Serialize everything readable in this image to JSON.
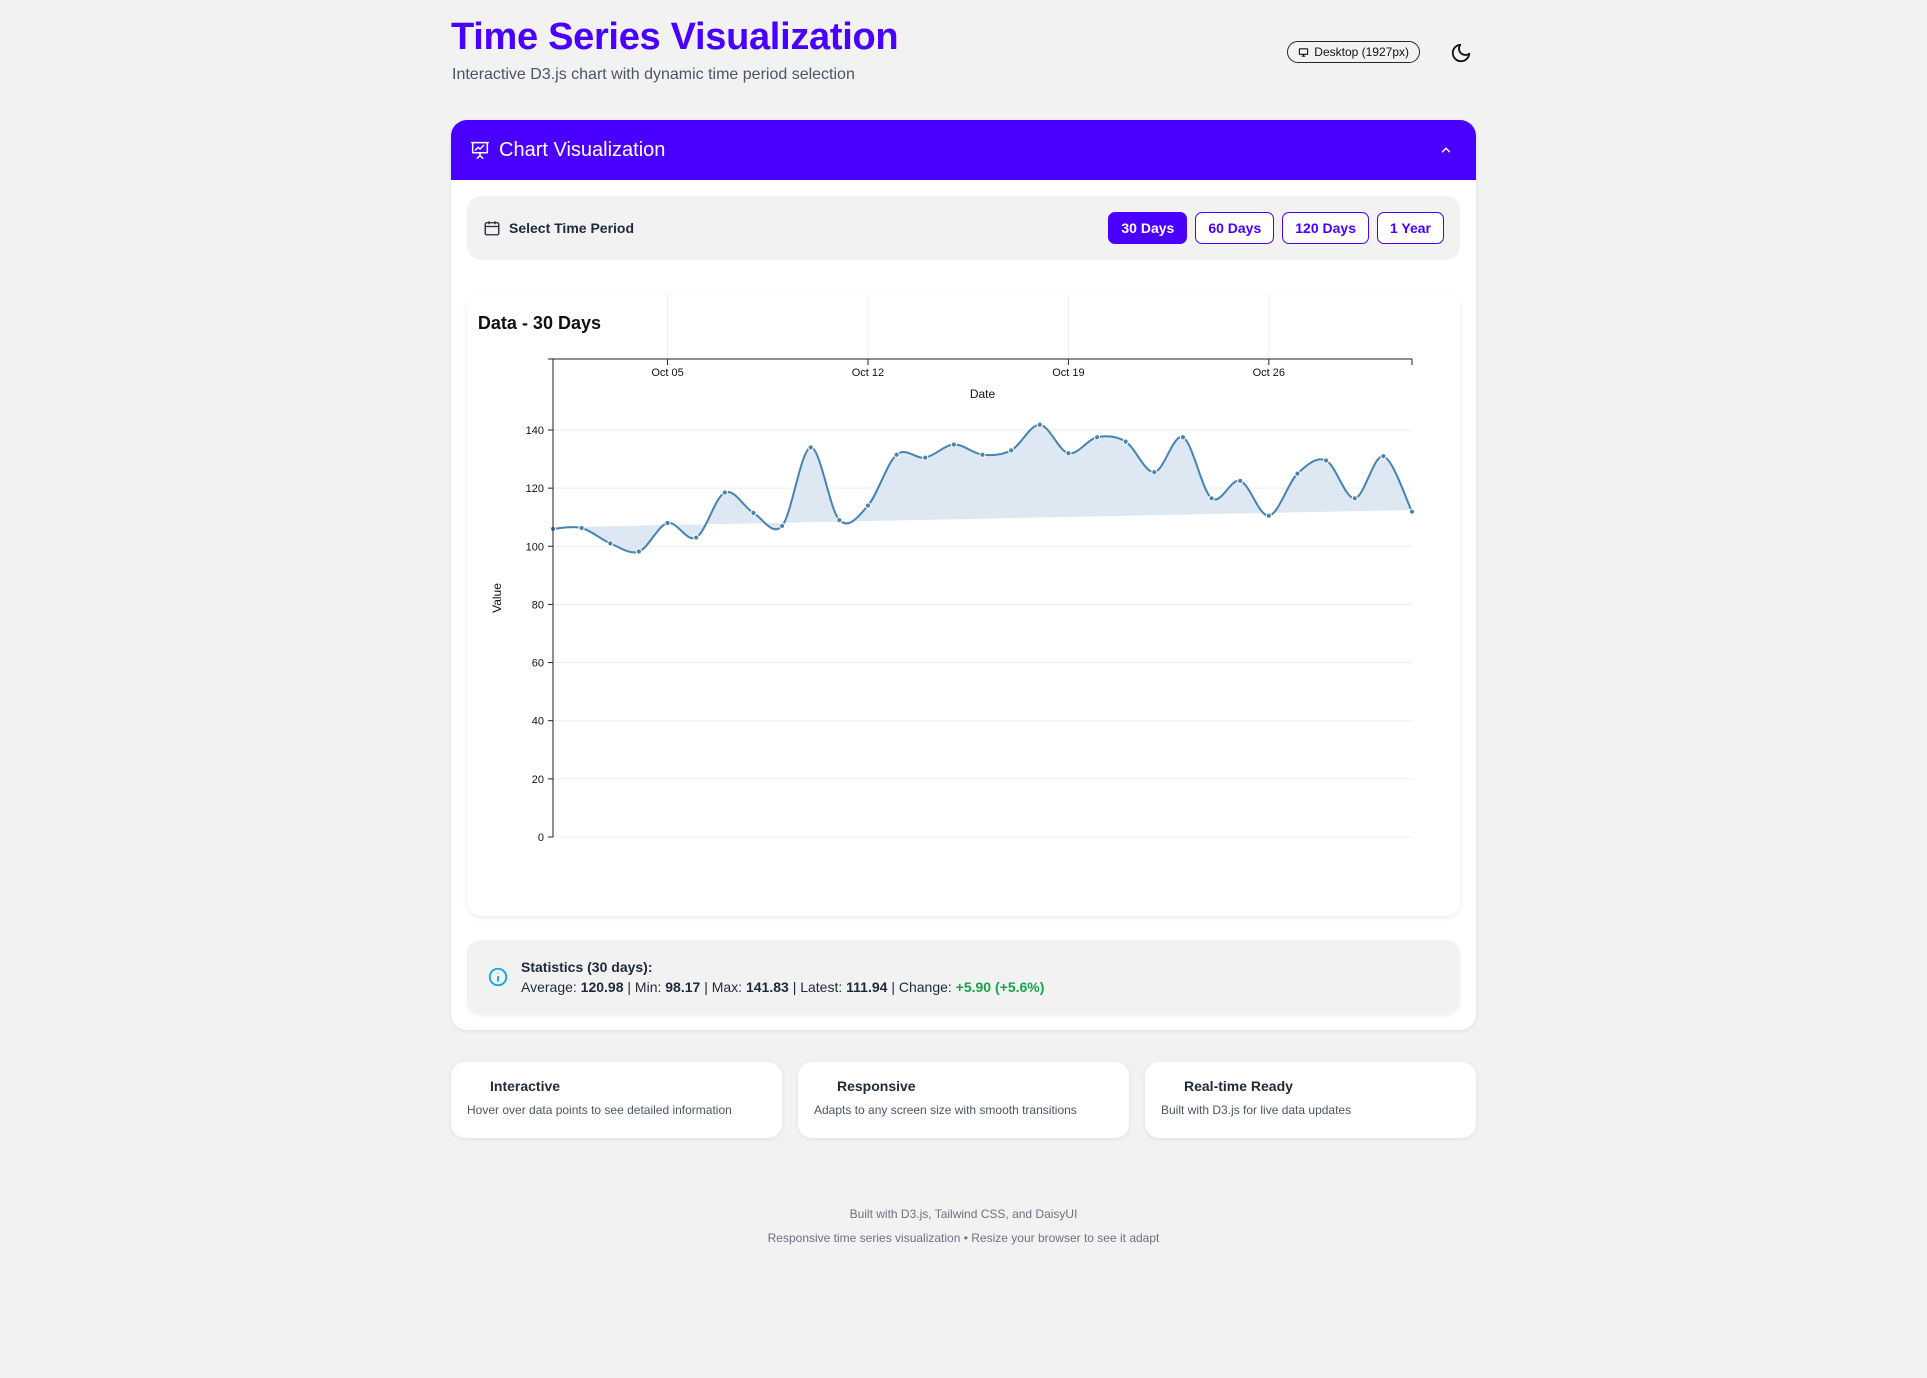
{
  "header": {
    "title": "Time Series Visualization",
    "subtitle": "Interactive D3.js chart with dynamic time period selection",
    "viewport_badge": "Desktop (1927px)",
    "theme_icon": "moon-icon"
  },
  "card": {
    "title": "Chart Visualization",
    "header_icon": "presentation-chart-icon",
    "accent_color": "#4a00ff"
  },
  "period_selector": {
    "label": "Select Time Period",
    "icon": "calendar-icon",
    "options": [
      "30 Days",
      "60 Days",
      "120 Days",
      "1 Year"
    ],
    "selected": "30 Days"
  },
  "chart_data": {
    "type": "line",
    "title": "Data - 30 Days",
    "xlabel": "Date",
    "ylabel": "Value",
    "ylim": [
      0,
      150
    ],
    "yticks": [
      0,
      20,
      40,
      60,
      80,
      100,
      120,
      140
    ],
    "xticks": [
      "Oct 05",
      "Oct 12",
      "Oct 19",
      "Oct 26"
    ],
    "x_axis_position": "top",
    "grid": true,
    "series": [
      {
        "x": [
          "2024-10-01",
          "2024-10-02",
          "2024-10-03",
          "2024-10-04",
          "2024-10-05",
          "2024-10-06",
          "2024-10-07",
          "2024-10-08",
          "2024-10-09",
          "2024-10-10",
          "2024-10-11",
          "2024-10-12",
          "2024-10-13",
          "2024-10-14",
          "2024-10-15",
          "2024-10-16",
          "2024-10-17",
          "2024-10-18",
          "2024-10-19",
          "2024-10-20",
          "2024-10-21",
          "2024-10-22",
          "2024-10-23",
          "2024-10-24",
          "2024-10-25",
          "2024-10-26",
          "2024-10-27",
          "2024-10-28",
          "2024-10-29",
          "2024-10-30",
          "2024-10-31"
        ],
        "values": [
          106.0,
          106.3,
          101.0,
          98.2,
          108.0,
          103.0,
          118.5,
          111.5,
          107.0,
          134.0,
          109.0,
          114.0,
          131.5,
          130.5,
          135.0,
          131.5,
          133.0,
          141.8,
          132.0,
          137.5,
          136.0,
          125.5,
          137.5,
          116.5,
          122.5,
          110.5,
          125.0,
          129.5,
          116.5,
          131.0,
          111.9
        ],
        "trend": [
          106.5,
          112.5
        ],
        "color": "#4682b4",
        "fill": "#dde8f2"
      }
    ]
  },
  "statistics": {
    "title": "Statistics (30 days):",
    "average_label": "Average:",
    "average": "120.98",
    "min_label": "Min:",
    "min": "98.17",
    "max_label": "Max:",
    "max": "141.83",
    "latest_label": "Latest:",
    "latest": "111.94",
    "change_label": "Change:",
    "change": "+5.90 (+5.6%)",
    "separator": "|"
  },
  "features": [
    {
      "title": "Interactive",
      "desc": "Hover over data points to see detailed information"
    },
    {
      "title": "Responsive",
      "desc": "Adapts to any screen size with smooth transitions"
    },
    {
      "title": "Real-time Ready",
      "desc": "Built with D3.js for live data updates"
    }
  ],
  "footer": {
    "line1": "Built with D3.js, Tailwind CSS, and DaisyUI",
    "line2": "Responsive time series visualization • Resize your browser to see it adapt"
  }
}
